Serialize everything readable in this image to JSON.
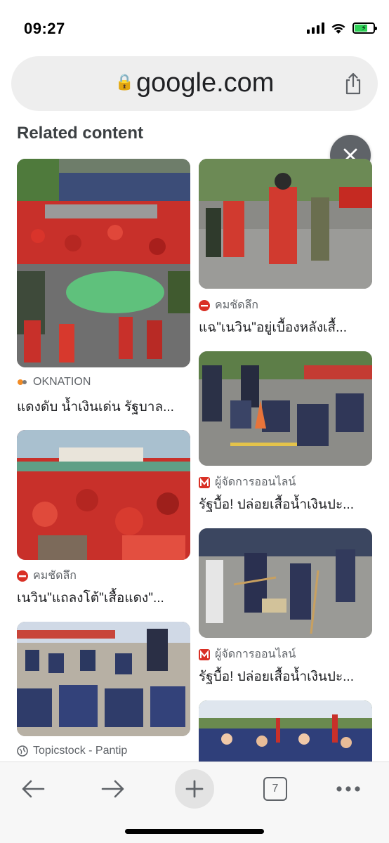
{
  "status_bar": {
    "time": "09:27"
  },
  "address_bar": {
    "domain": "google.com",
    "lock_glyph": "🔒"
  },
  "section": {
    "title": "Related content"
  },
  "cards": [
    {
      "source": "OKNATION",
      "title": "แดงดับ น้ำเงินเด่น รัฐบาล...",
      "source_icon": "oknation-logo-icon"
    },
    {
      "source": "คมชัดลึก",
      "title": "แฉ\"เนวิน\"อยู่เบื้องหลังเสื้...",
      "source_icon": "komchadluek-logo-icon"
    },
    {
      "source": "ผู้จัดการออนไลน์",
      "title": "รัฐบื้อ! ปล่อยเสื้อน้ำเงินปะ...",
      "source_icon": "manager-logo-icon"
    },
    {
      "source": "คมชัดลึก",
      "title": "เนวิน\"แถลงโต้\"เสื้อแดง\"...",
      "source_icon": "komchadluek-logo-icon"
    },
    {
      "source": "ผู้จัดการออนไลน์",
      "title": "รัฐบื้อ! ปล่อยเสื้อน้ำเงินปะ...",
      "source_icon": "manager-logo-icon"
    },
    {
      "source": "Topicstock - Pantip",
      "title": "",
      "source_icon": "globe-icon"
    }
  ],
  "toolbar": {
    "tab_count": "7"
  },
  "colors": {
    "accent_red": "#d93025",
    "toolbar_bg": "#f7f7f7",
    "address_bg": "#eeeeee",
    "close_bg": "#5f6368"
  }
}
